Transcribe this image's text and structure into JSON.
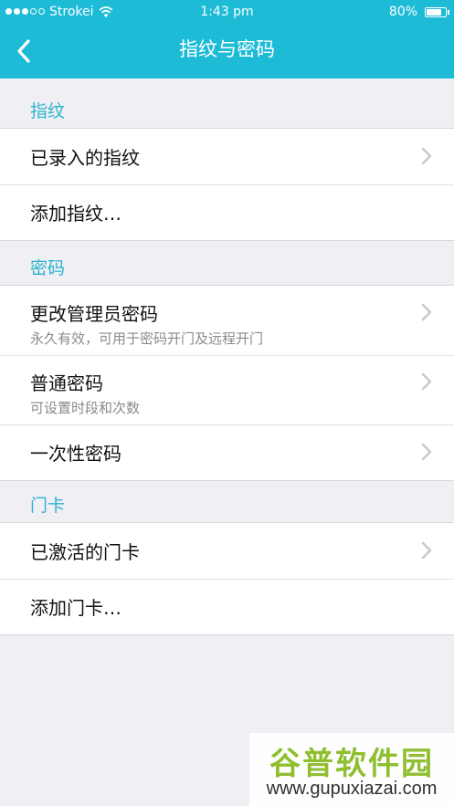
{
  "status_bar": {
    "carrier": "Strokei",
    "time": "1:43 pm",
    "battery": "80%",
    "battery_level": 0.8,
    "signal_bars_filled": 3,
    "signal_bars_total": 5
  },
  "nav": {
    "title": "指纹与密码",
    "back_icon": "chevron-left-icon"
  },
  "sections": [
    {
      "header": "指纹",
      "rows": [
        {
          "label": "已录入的指纹",
          "chevron": true
        },
        {
          "label": "添加指纹…",
          "chevron": false
        }
      ]
    },
    {
      "header": "密码",
      "rows": [
        {
          "label": "更改管理员密码",
          "subtitle": "永久有效，可用于密码开门及远程开门",
          "chevron": true
        },
        {
          "label": "普通密码",
          "subtitle": "可设置时段和次数",
          "chevron": true
        },
        {
          "label": "一次性密码",
          "chevron": true
        }
      ]
    },
    {
      "header": "门卡",
      "rows": [
        {
          "label": "已激活的门卡",
          "chevron": true
        },
        {
          "label": "添加门卡…",
          "chevron": false
        }
      ]
    }
  ],
  "watermark": {
    "title": "谷普软件园",
    "url": "www.gupuxiazai.com"
  },
  "colors": {
    "accent": "#1ebbd7",
    "section_header": "#2ab4cf",
    "background": "#efeff4",
    "subtitle": "#8a8a8a"
  }
}
